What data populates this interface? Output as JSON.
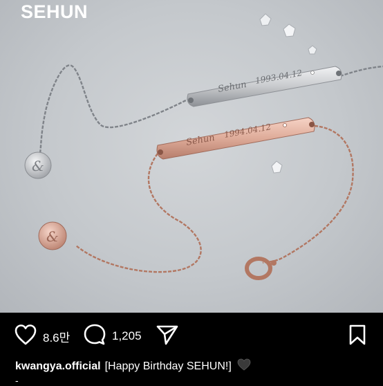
{
  "post": {
    "image": {
      "brand_text": "SEHUN",
      "silver_bar_text": "Sehun",
      "silver_bar_date": "1993.04.12",
      "rose_bar_text": "Sehun",
      "rose_bar_date": "1994.04.12"
    },
    "actions": {
      "like_icon": "heart-outline-icon",
      "like_count": "8.6만",
      "comment_icon": "comment-bubble-icon",
      "comment_count": "1,205",
      "share_icon": "paper-plane-icon",
      "save_icon": "bookmark-icon"
    },
    "caption": {
      "username": "kwangya.official",
      "text": "[Happy Birthday SEHUN!]",
      "emoji_icon": "black-heart-icon",
      "more": "-"
    }
  },
  "colors": {
    "background": "#000000",
    "text": "#ffffff",
    "silver": "#c9cbce",
    "rose_gold": "#d9a796"
  }
}
